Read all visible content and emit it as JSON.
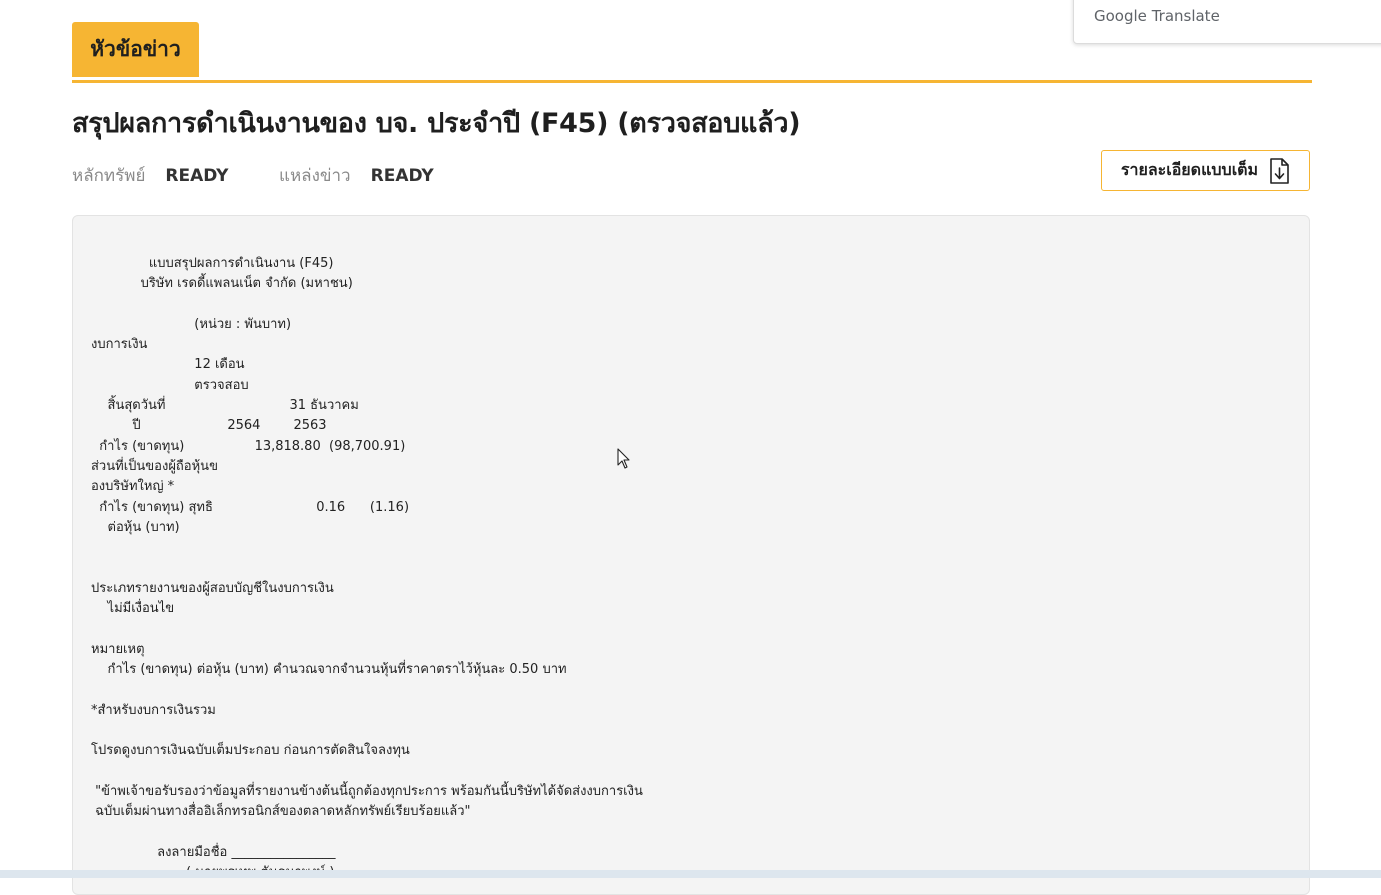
{
  "header": {
    "tab_label": "หัวข้อข่าว",
    "title": "สรุปผลการดำเนินงานของ บจ. ประจำปี (F45) (ตรวจสอบแล้ว)",
    "security_label": "หลักทรัพย์",
    "security_value": "READY",
    "source_label": "แหล่งข่าว",
    "source_value": "READY",
    "full_detail_button": "รายละเอียดแบบเต็ม",
    "full_detail_icon": "file-download-icon"
  },
  "google_translate": {
    "brand": "Google",
    "product": "Translate"
  },
  "document": {
    "text": "              แบบสรุปผลการดำเนินงาน (F45)\n            บริษัท เรดดี้แพลนเน็ต จำกัด (มหาชน)\n\n                         (หน่วย : พันบาท)\nงบการเงิน\n                         12 เดือน\n                         ตรวจสอบ\n    สิ้นสุดวันที่                              31 ธันวาคม\n          ปี                     2564        2563\n  กำไร (ขาดทุน)                 13,818.80  (98,700.91)\nส่วนที่เป็นของผู้ถือหุ้นข\nองบริษัทใหญ่ *\n  กำไร (ขาดทุน) สุทธิ                         0.16      (1.16)\n    ต่อหุ้น (บาท)\n\n\nประเภทรายงานของผู้สอบบัญชีในงบการเงิน\n    ไม่มีเงื่อนไข\n\nหมายเหตุ\n    กำไร (ขาดทุน) ต่อหุ้น (บาท) คำนวณจากจำนวนหุ้นที่ราคาตราไว้หุ้นละ 0.50 บาท\n\n*สำหรับงบการเงินรวม\n\nโปรดดูงบการเงินฉบับเต็มประกอบ ก่อนการตัดสินใจลงทุน\n\n \"ข้าพเจ้าขอรับรองว่าข้อมูลที่รายงานข้างต้นนี้ถูกต้องทุกประการ พร้อมกันนี้บริษัทได้จัดส่งงบการเงิน\n ฉบับเต็มผ่านทางสื่ออิเล็กทรอนิกส์ของตลาดหลักทรัพย์เรียบร้อยแล้ว\"\n\n                ลงลายมือชื่อ ________________\n                       ( นายพรเทพ ตันธนาพงษ์ )"
  }
}
